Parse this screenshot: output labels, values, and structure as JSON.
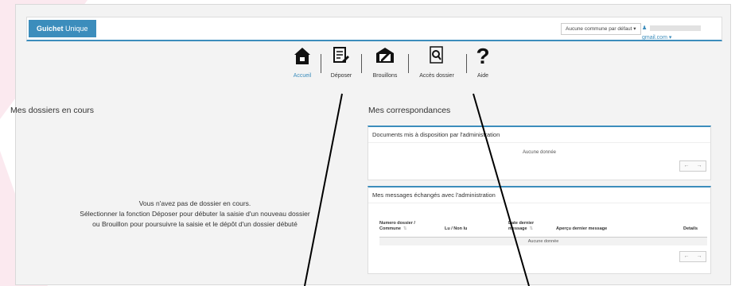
{
  "navbar": {
    "brand_bold": "Guichet",
    "brand_rest": " Unique",
    "commune_select": "Aucune commune par défaut",
    "user_email_suffix": "gmail.com"
  },
  "toolbar": {
    "items": [
      {
        "label": "Accueil",
        "icon": "home-icon",
        "active": true
      },
      {
        "label": "Déposer",
        "icon": "document-edit-icon"
      },
      {
        "label": "Brouillons",
        "icon": "drafts-folder-icon"
      },
      {
        "label": "Accès dossier",
        "icon": "search-document-icon"
      },
      {
        "label": "Aide",
        "icon": "question-mark-icon"
      }
    ]
  },
  "dossiers": {
    "title": "Mes dossiers en cours",
    "empty_lines": [
      "Vous n'avez pas de dossier en cours.",
      "Sélectionner la fonction Déposer pour débuter la saisie d'un nouveau dossier",
      "ou Brouillon pour poursuivre la saisie et le dépôt d'un dossier débuté"
    ]
  },
  "correspondances": {
    "title": "Mes correspondances",
    "documents": {
      "title": "Documents mis à disposition par l'administration",
      "no_data": "Aucune donnée"
    },
    "messages": {
      "title": "Mes messages échangés avec l'administration",
      "columns": [
        "Numero dossier / Commune",
        "Lu / Non lu",
        "Date dernier message",
        "Aperçu dernier message",
        "Details"
      ],
      "no_data": "Aucune donnée"
    },
    "pager_prev": "←",
    "pager_next": "→"
  },
  "colors": {
    "accent": "#3c8dbc",
    "background": "#f3f3f3",
    "decor_pink": "#fbe9ef"
  }
}
